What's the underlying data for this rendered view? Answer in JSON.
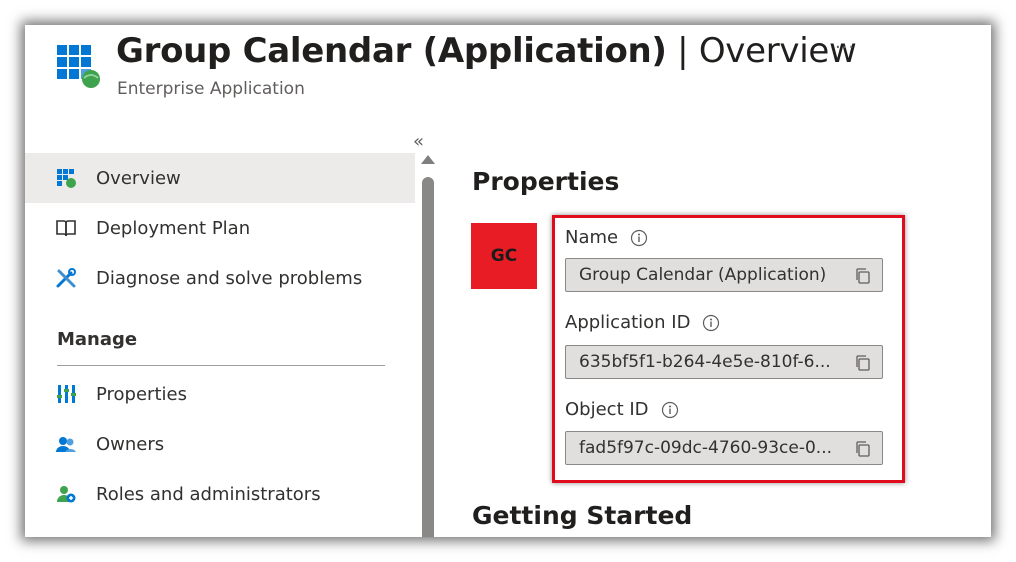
{
  "header": {
    "title": "Group Calendar (Application)",
    "separator": " | ",
    "section": "Overview",
    "more": "···",
    "subtitle": "Enterprise Application",
    "collapse": "«"
  },
  "sidebar": {
    "items": [
      {
        "label": "Overview",
        "icon": "grid-icon",
        "active": true
      },
      {
        "label": "Deployment Plan",
        "icon": "book-icon"
      },
      {
        "label": "Diagnose and solve problems",
        "icon": "tools-icon"
      }
    ],
    "manage_heading": "Manage",
    "manage_items": [
      {
        "label": "Properties",
        "icon": "properties-icon"
      },
      {
        "label": "Owners",
        "icon": "owners-icon"
      },
      {
        "label": "Roles and administrators",
        "icon": "roles-icon"
      }
    ]
  },
  "properties": {
    "heading": "Properties",
    "avatar_initials": "GC",
    "fields": [
      {
        "label": "Name",
        "value": "Group Calendar (Application)"
      },
      {
        "label": "Application ID",
        "value": "635bf5f1-b264-4e5e-810f-6..."
      },
      {
        "label": "Object ID",
        "value": "fad5f97c-09dc-4760-93ce-0..."
      }
    ]
  },
  "getting_started": {
    "heading": "Getting Started"
  },
  "colors": {
    "avatar": "#e81c24",
    "highlight": "#e00b1c",
    "azure_blue": "#0078d4"
  }
}
